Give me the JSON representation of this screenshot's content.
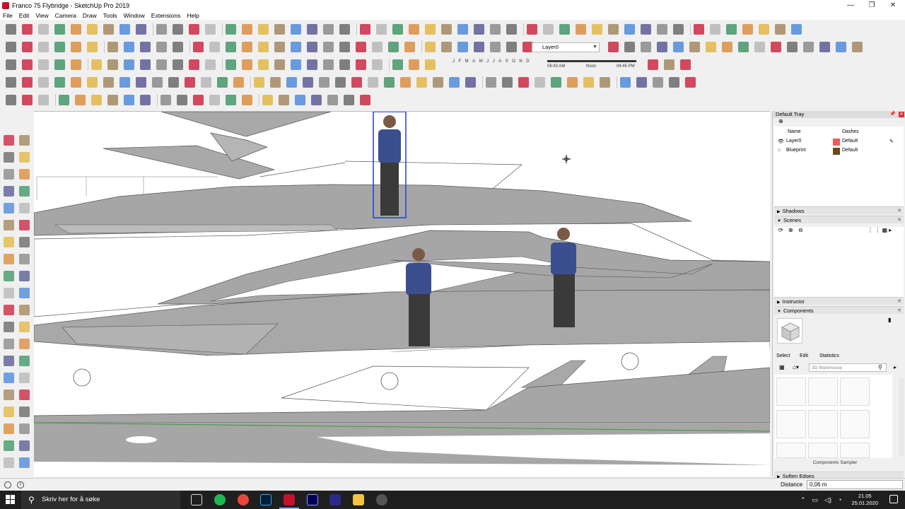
{
  "window": {
    "title": "Franco 75 Flybridge - SketchUp Pro 2019",
    "controls": [
      "—",
      "❐",
      "✕"
    ]
  },
  "menu": [
    "File",
    "Edit",
    "View",
    "Camera",
    "Draw",
    "Tools",
    "Window",
    "Extensions",
    "Help"
  ],
  "layer_toolbar": {
    "current_layer": "Layer0"
  },
  "shadow_settings": {
    "months": [
      "J",
      "F",
      "M",
      "A",
      "M",
      "J",
      "J",
      "A",
      "S",
      "O",
      "N",
      "D"
    ],
    "time_start": "06:43 AM",
    "time_mid": "Noon",
    "time_end": "04:45 PM"
  },
  "tray": {
    "title": "Default Tray",
    "layers": {
      "col_name": "Name",
      "col_dashes": "Dashes",
      "rows": [
        {
          "name": "Layer0",
          "dashes": "Default",
          "color": "#f05a5a",
          "visible_icon": "eye-icon"
        },
        {
          "name": "Blueprint",
          "dashes": "Default",
          "color": "#6b4a1a",
          "visible_icon": "hidden-circle-icon"
        }
      ]
    },
    "sections": {
      "shadows": "Shadows",
      "scenes": "Scenes",
      "instructor": "Instructor",
      "components": "Components",
      "soften_edges": "Soften Edges"
    },
    "component_tabs": [
      "Select",
      "Edit",
      "Statistics"
    ],
    "component_search_placeholder": "3D Warehouse",
    "component_caption": "Components Sampler"
  },
  "status": {
    "distance_label": "Distance",
    "distance_value": "0,06 m"
  },
  "taskbar": {
    "search_placeholder": "Skriv her for å søke",
    "time": "21.05",
    "date": "25.01.2020"
  },
  "colors": {
    "hull_gray": "#a6a6a6",
    "dark_gray": "#8c8c8c",
    "selection_blue": "#1f3fd8",
    "person_shirt": "#3b4f8e",
    "accent_red": "#c8102e"
  }
}
